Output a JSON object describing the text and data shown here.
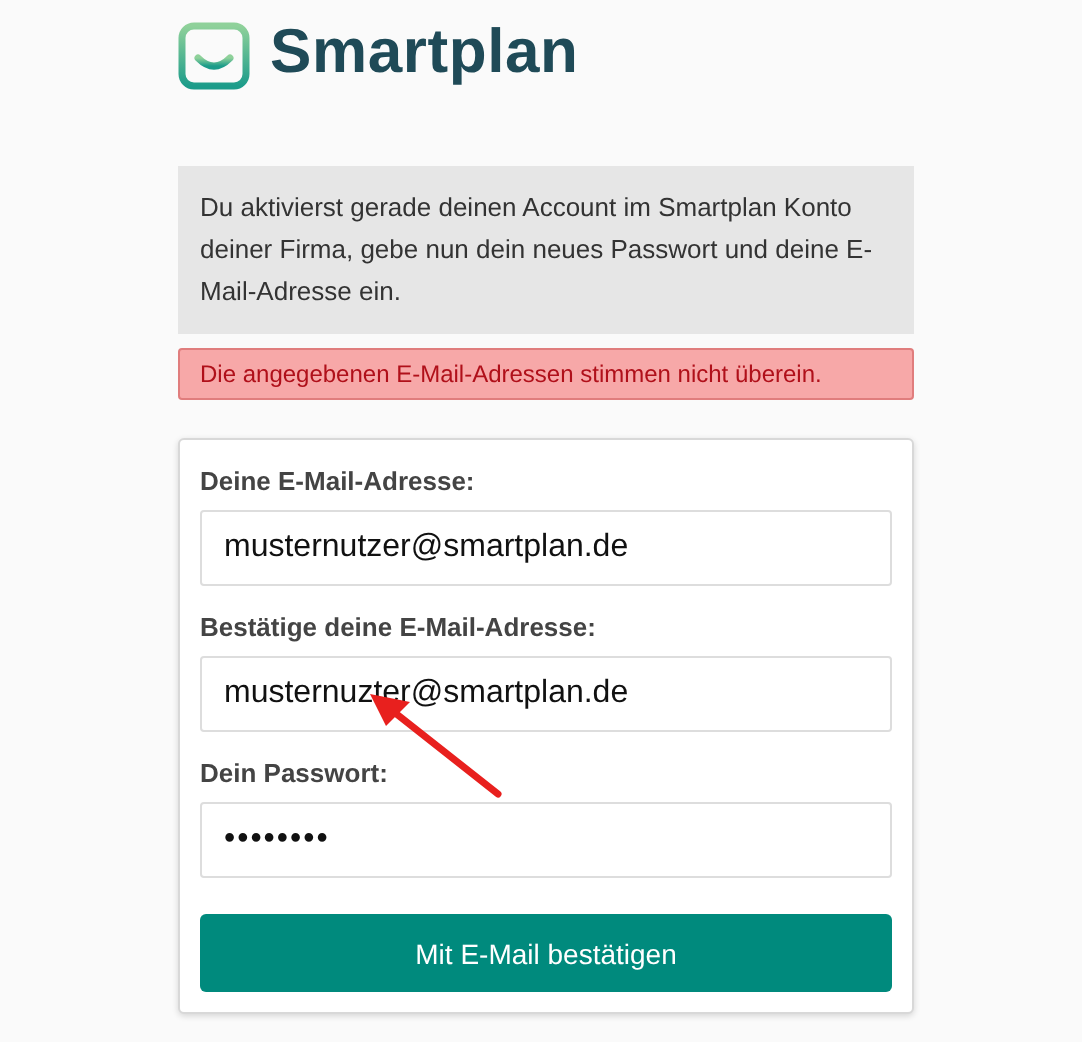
{
  "brand": {
    "name": "Smartplan"
  },
  "notice": {
    "text": "Du aktivierst gerade deinen Account im Smartplan Konto deiner Firma, gebe nun dein neues Passwort und deine E-Mail-Adresse ein."
  },
  "error": {
    "text": "Die angegebenen E-Mail-Adressen stimmen nicht überein."
  },
  "form": {
    "fields": [
      {
        "label": "Deine E-Mail-Adresse:",
        "value": "musternutzer@smartplan.de",
        "kind": "text"
      },
      {
        "label": "Bestätige deine E-Mail-Adresse:",
        "value": "musternuzter@smartplan.de",
        "kind": "text"
      },
      {
        "label": "Dein Passwort:",
        "value": "••••••••",
        "kind": "password"
      }
    ],
    "submit": "Mit E-Mail bestätigen"
  }
}
